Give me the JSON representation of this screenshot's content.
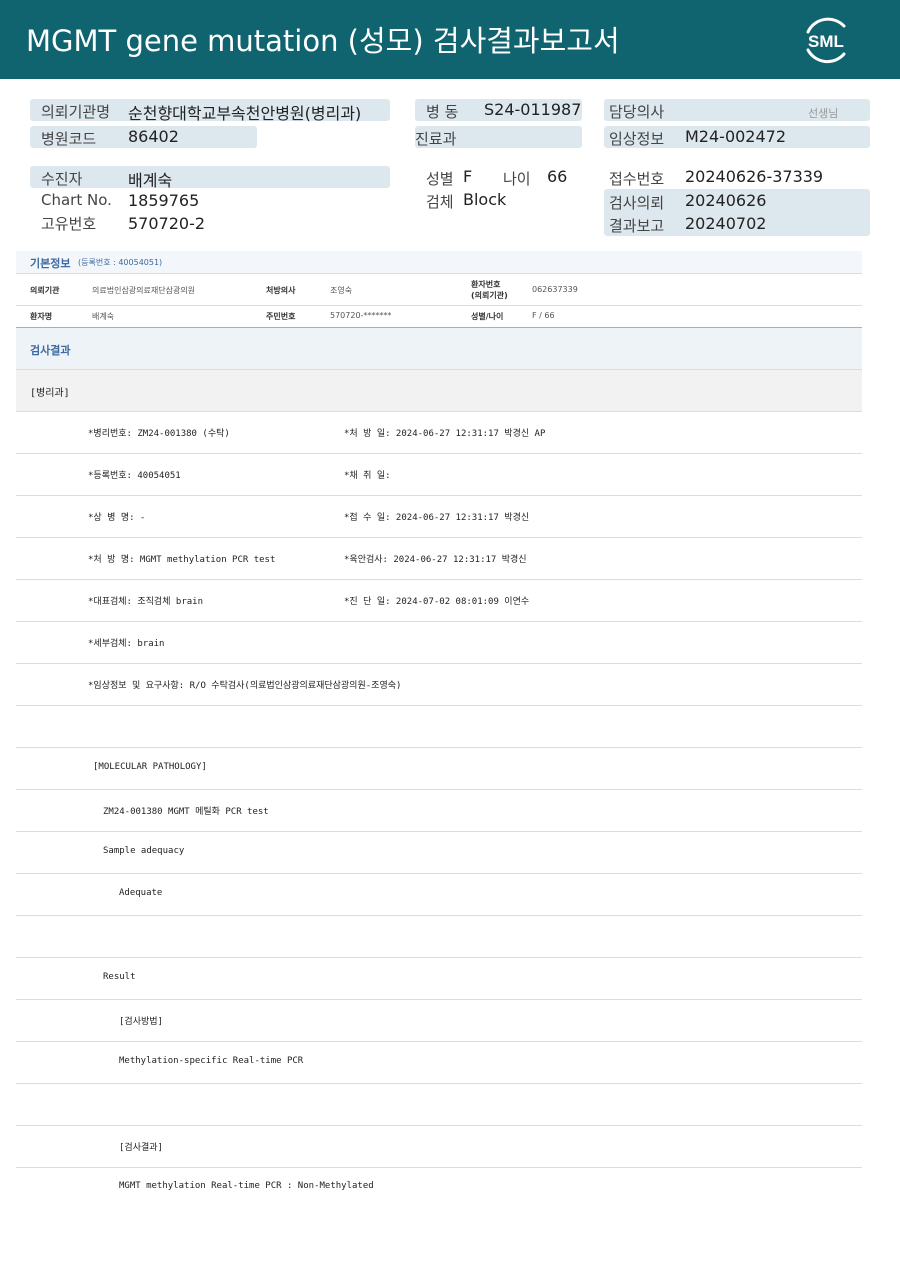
{
  "header": {
    "title": "MGMT gene mutation (성모) 검사결과보고서",
    "logo_text": "SML"
  },
  "patient_info": {
    "institution_label": "의뢰기관명",
    "institution_value": "순천향대학교부속천안병원(병리과)",
    "ward_label": "병 동",
    "ward_value": "S24-011987",
    "doctor_label": "담당의사",
    "doctor_suffix": "선생님",
    "hospital_code_label": "병원코드",
    "hospital_code_value": "86402",
    "department_label": "진료과",
    "clinical_label": "임상정보",
    "clinical_value": "M24-002472",
    "examinee_label": "수진자",
    "examinee_value": "배계숙",
    "sex_label": "성별",
    "sex_value": "F",
    "age_label": "나이",
    "age_value": "66",
    "receipt_label": "접수번호",
    "receipt_value": "20240626-37339",
    "chart_label": "Chart No.",
    "chart_value": "1859765",
    "specimen_label": "검체",
    "specimen_value": "Block",
    "request_label": "검사의뢰",
    "request_value": "20240626",
    "id_label": "고유번호",
    "id_value": "570720-2",
    "report_label": "결과보고",
    "report_value": "20240702"
  },
  "basic_info": {
    "title": "기본정보",
    "reg_note": "(등록번호 : 40054051)",
    "row1": {
      "inst_label": "의뢰기관",
      "inst_value": "의료법인삼광의료재단삼광의원",
      "prescriber_label": "처방의사",
      "prescriber_value": "조영숙",
      "patient_no_label_1": "환자번호",
      "patient_no_label_2": "(의뢰기관)",
      "patient_no_value": "062637339"
    },
    "row2": {
      "name_label": "환자명",
      "name_value": "배계숙",
      "rrn_label": "주민번호",
      "rrn_value": "570720-*******",
      "sexage_label": "성별/나이",
      "sexage_value": "F / 66"
    }
  },
  "result": {
    "title": "검사결과",
    "dept": "[병리과]",
    "rows": [
      {
        "left": "*병리번호: ZM24-001380 (수탁)",
        "right": "*처 방 일: 2024-06-27 12:31:17  박경신 AP"
      },
      {
        "left": "*등록번호: 40054051",
        "right": "*채 취 일:"
      },
      {
        "left": "*상 병 명: -",
        "right": "*접 수 일: 2024-06-27 12:31:17  박경신"
      },
      {
        "left": "*처 방 명: MGMT methylation  PCR test",
        "right": "*육안검사: 2024-06-27 12:31:17  박경신"
      },
      {
        "left": "*대표검체: 조직검체 brain",
        "right": "*진 단 일: 2024-07-02 08:01:09  이연수"
      },
      {
        "left": "*세부검체: brain",
        "right": ""
      },
      {
        "left": "*임상정보 및 요구사항: R/O 수탁검사(의료법인삼광의료재단삼광의원-조영숙)",
        "right": ""
      }
    ],
    "molecular": "[MOLECULAR PATHOLOGY]",
    "test_line": "ZM24-001380     MGMT 메틸화  PCR test",
    "adequacy_label": "Sample adequacy",
    "adequacy_value": "Adequate",
    "result_label": "Result",
    "method_label": "[검사방법]",
    "method_value": "Methylation-specific Real-time PCR",
    "outcome_label": "[검사결과]",
    "outcome_value": "MGMT methylation Real-time PCR : Non-Methylated"
  }
}
